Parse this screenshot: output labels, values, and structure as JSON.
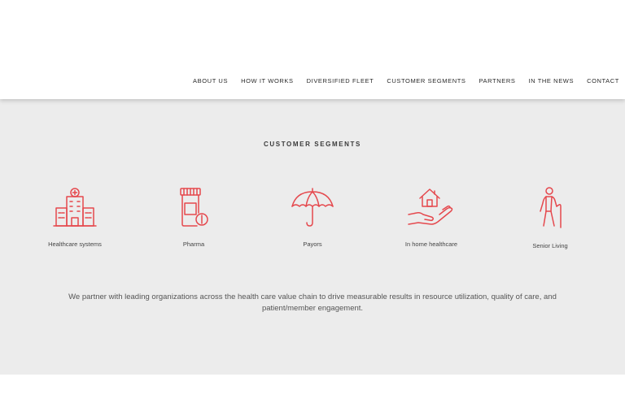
{
  "nav": {
    "items": [
      "ABOUT US",
      "HOW IT WORKS",
      "DIVERSIFIED FLEET",
      "CUSTOMER SEGMENTS",
      "PARTNERS",
      "IN THE NEWS",
      "CONTACT"
    ]
  },
  "section": {
    "title": "CUSTOMER SEGMENTS",
    "segments": [
      {
        "label": "Healthcare systems",
        "icon": "hospital-icon"
      },
      {
        "label": "Pharma",
        "icon": "pill-bottle-icon"
      },
      {
        "label": "Payors",
        "icon": "umbrella-icon"
      },
      {
        "label": "In home healthcare",
        "icon": "house-hand-icon"
      },
      {
        "label": "Senior Living",
        "icon": "senior-cane-icon"
      }
    ],
    "description": "We partner with leading organizations across the health care value chain to drive measurable results in resource utilization, quality of care, and patient/member engagement."
  },
  "colors": {
    "accent": "#e5484d",
    "section_bg": "#ececec",
    "header_bg": "#ffffff"
  }
}
